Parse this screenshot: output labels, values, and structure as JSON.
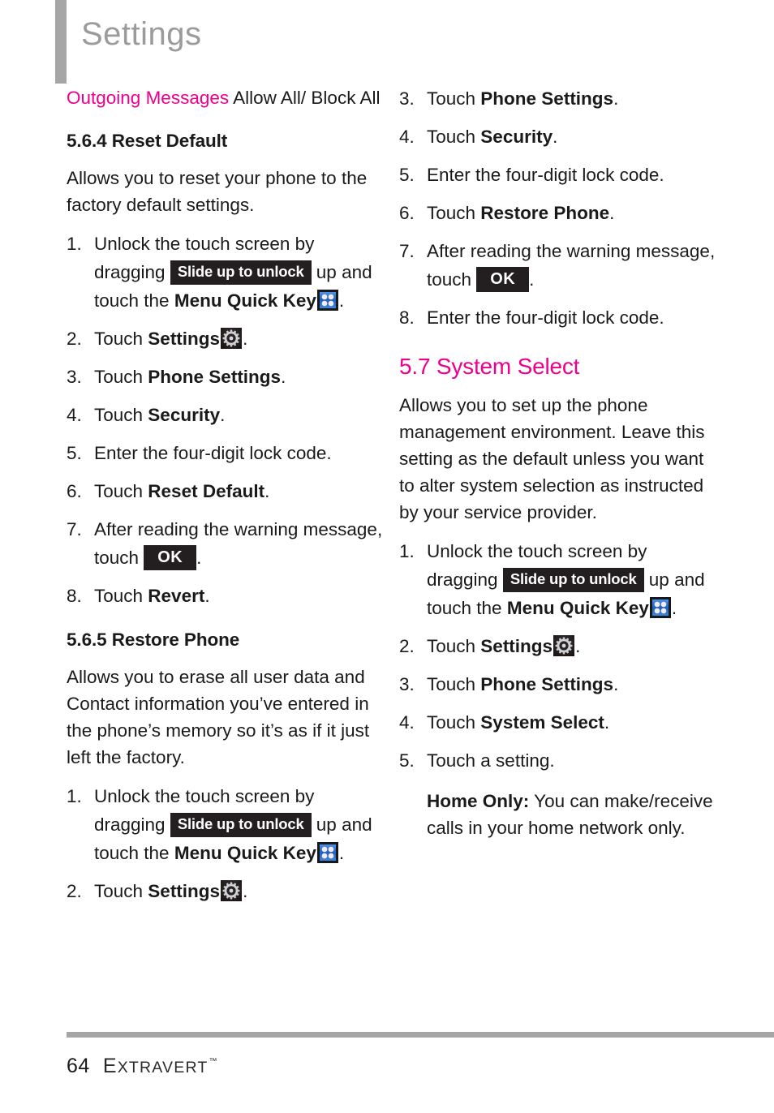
{
  "header": {
    "title": "Settings"
  },
  "colors": {
    "accent_magenta": "#ec008c",
    "header_gray": "#9b9b9b",
    "rule_gray": "#a6a6a6",
    "badge_black": "#231f20",
    "quickkey_blue": "#2e7fe0",
    "text_black": "#1a1a1a"
  },
  "left_column": {
    "continued_entry": {
      "term": "Outgoing Messages",
      "value": "Allow All/ Block All"
    },
    "section_564": {
      "heading": "5.6.4 Reset Default",
      "intro": "Allows you to reset your phone to the factory default settings.",
      "steps": [
        {
          "num": "1.",
          "parts": [
            {
              "type": "text",
              "value": "Unlock the touch screen by dragging "
            },
            {
              "type": "badge",
              "value": "Slide up to unlock"
            },
            {
              "type": "text",
              "value": " up and touch the "
            },
            {
              "type": "bold",
              "value": "Menu Quick Key"
            },
            {
              "type": "icon",
              "value": "menu-quick-key-icon"
            },
            {
              "type": "text",
              "value": "."
            }
          ]
        },
        {
          "num": "2.",
          "parts": [
            {
              "type": "text",
              "value": "Touch "
            },
            {
              "type": "bold",
              "value": "Settings"
            },
            {
              "type": "icon",
              "value": "settings-gear-icon"
            },
            {
              "type": "text",
              "value": "."
            }
          ]
        },
        {
          "num": "3.",
          "parts": [
            {
              "type": "text",
              "value": "Touch "
            },
            {
              "type": "bold",
              "value": "Phone Settings"
            },
            {
              "type": "text",
              "value": "."
            }
          ]
        },
        {
          "num": "4.",
          "parts": [
            {
              "type": "text",
              "value": "Touch "
            },
            {
              "type": "bold",
              "value": "Security"
            },
            {
              "type": "text",
              "value": "."
            }
          ]
        },
        {
          "num": "5.",
          "parts": [
            {
              "type": "text",
              "value": "Enter the four-digit lock code."
            }
          ]
        },
        {
          "num": "6.",
          "parts": [
            {
              "type": "text",
              "value": "Touch "
            },
            {
              "type": "bold",
              "value": "Reset Default"
            },
            {
              "type": "text",
              "value": "."
            }
          ]
        },
        {
          "num": "7.",
          "parts": [
            {
              "type": "text",
              "value": "After reading the warning message, touch "
            },
            {
              "type": "badge-ok",
              "value": "OK"
            },
            {
              "type": "text",
              "value": "."
            }
          ]
        },
        {
          "num": "8.",
          "parts": [
            {
              "type": "text",
              "value": "Touch "
            },
            {
              "type": "bold",
              "value": "Revert"
            },
            {
              "type": "text",
              "value": "."
            }
          ]
        }
      ]
    },
    "section_565": {
      "heading": "5.6.5 Restore Phone",
      "intro": "Allows you to erase all user data and Contact information you’ve entered in the phone’s memory so it’s as if it just left the factory.",
      "steps": [
        {
          "num": "1.",
          "parts": [
            {
              "type": "text",
              "value": "Unlock the touch screen by dragging "
            },
            {
              "type": "badge",
              "value": "Slide up to unlock"
            },
            {
              "type": "text",
              "value": " up and touch the "
            },
            {
              "type": "bold",
              "value": "Menu Quick Key"
            },
            {
              "type": "icon",
              "value": "menu-quick-key-icon"
            },
            {
              "type": "text",
              "value": "."
            }
          ]
        },
        {
          "num": "2.",
          "parts": [
            {
              "type": "text",
              "value": "Touch "
            },
            {
              "type": "bold",
              "value": "Settings"
            },
            {
              "type": "icon",
              "value": "settings-gear-icon"
            },
            {
              "type": "text",
              "value": "."
            }
          ]
        }
      ]
    }
  },
  "right_column": {
    "section_565_continued": {
      "steps": [
        {
          "num": "3.",
          "parts": [
            {
              "type": "text",
              "value": "Touch "
            },
            {
              "type": "bold",
              "value": "Phone Settings"
            },
            {
              "type": "text",
              "value": "."
            }
          ]
        },
        {
          "num": "4.",
          "parts": [
            {
              "type": "text",
              "value": "Touch "
            },
            {
              "type": "bold",
              "value": "Security"
            },
            {
              "type": "text",
              "value": "."
            }
          ]
        },
        {
          "num": "5.",
          "parts": [
            {
              "type": "text",
              "value": "Enter the four-digit lock code."
            }
          ]
        },
        {
          "num": "6.",
          "parts": [
            {
              "type": "text",
              "value": "Touch "
            },
            {
              "type": "bold",
              "value": "Restore Phone"
            },
            {
              "type": "text",
              "value": "."
            }
          ]
        },
        {
          "num": "7.",
          "parts": [
            {
              "type": "text",
              "value": "After reading the warning message, touch "
            },
            {
              "type": "badge-ok",
              "value": "OK"
            },
            {
              "type": "text",
              "value": "."
            }
          ]
        },
        {
          "num": "8.",
          "parts": [
            {
              "type": "text",
              "value": "Enter the four-digit lock code."
            }
          ]
        }
      ]
    },
    "section_57": {
      "heading": "5.7 System Select",
      "intro": "Allows you to set up the phone management environment. Leave this setting as the default unless you want to alter system selection as instructed by your service provider.",
      "steps": [
        {
          "num": "1.",
          "parts": [
            {
              "type": "text",
              "value": "Unlock the touch screen by dragging "
            },
            {
              "type": "badge",
              "value": "Slide up to unlock"
            },
            {
              "type": "text",
              "value": " up and touch the "
            },
            {
              "type": "bold",
              "value": "Menu Quick Key"
            },
            {
              "type": "icon",
              "value": "menu-quick-key-icon"
            },
            {
              "type": "text",
              "value": "."
            }
          ]
        },
        {
          "num": "2.",
          "parts": [
            {
              "type": "text",
              "value": "Touch "
            },
            {
              "type": "bold",
              "value": "Settings"
            },
            {
              "type": "icon",
              "value": "settings-gear-icon"
            },
            {
              "type": "text",
              "value": "."
            }
          ]
        },
        {
          "num": "3.",
          "parts": [
            {
              "type": "text",
              "value": "Touch "
            },
            {
              "type": "bold",
              "value": "Phone Settings"
            },
            {
              "type": "text",
              "value": "."
            }
          ]
        },
        {
          "num": "4.",
          "parts": [
            {
              "type": "text",
              "value": "Touch "
            },
            {
              "type": "bold",
              "value": "System Select"
            },
            {
              "type": "text",
              "value": "."
            }
          ]
        },
        {
          "num": "5.",
          "parts": [
            {
              "type": "text",
              "value": "Touch a setting."
            }
          ]
        }
      ],
      "note": {
        "term": "Home Only:",
        "body": " You can make/receive calls in your home network only."
      }
    }
  },
  "footer": {
    "page_number": "64",
    "brand_first_letter": "E",
    "brand_rest": "XTRAVERT",
    "trademark": "™"
  }
}
